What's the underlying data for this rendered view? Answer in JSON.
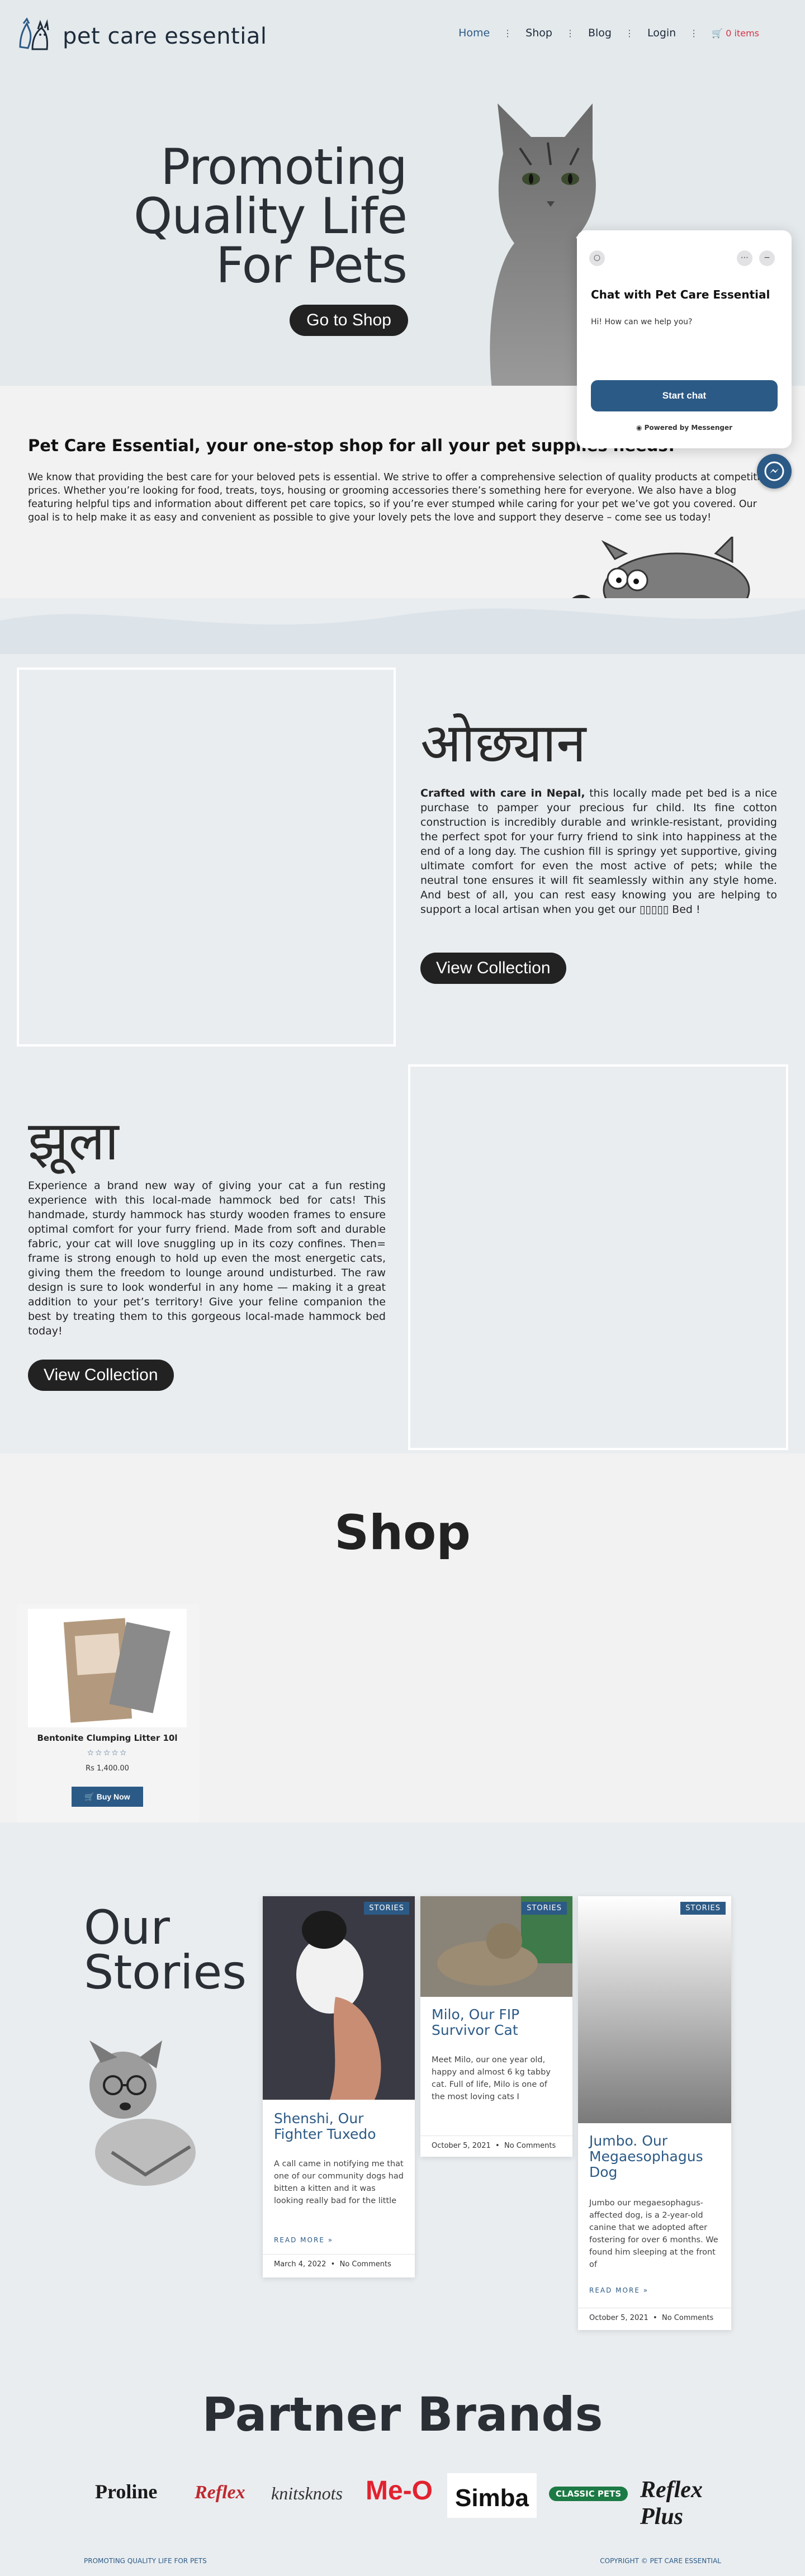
{
  "header": {
    "brand": "pet care essential",
    "nav": [
      {
        "label": "Home"
      },
      {
        "label": "Shop"
      },
      {
        "label": "Blog"
      },
      {
        "label": "Login"
      }
    ],
    "cart_label": "0 items"
  },
  "hero": {
    "title_line1": "Promoting",
    "title_line2": "Quality Life",
    "title_line3": "For Pets",
    "cta": "Go to Shop"
  },
  "chat": {
    "title": "Chat with Pet Care Essential",
    "subtitle": "Hi! How can we help you?",
    "button": "Start chat",
    "powered_by": "Powered by Messenger"
  },
  "intro": {
    "title": "Pet Care Essential, your one-stop shop for all your pet supplies needs!",
    "body": "We know that providing the best care for your beloved pets is essential. We strive to offer a comprehensive selection of quality products at competitive prices. Whether you’re looking for food, treats, toys, housing or grooming accessories there’s something here for everyone. We also have a blog featuring helpful tips and information about different pet care topics, so if you’re ever stumped while caring for your pet we’ve got you covered. Our goal is to help make it as easy and convenient as possible to give your lovely pets the love and support they deserve – come see us today!"
  },
  "bed": {
    "title": "ओछ्यान",
    "lead": "Crafted with care in Nepal,",
    "body": "this locally made pet bed is a nice purchase to pamper your precious fur child. Its fine cotton construction is incredibly durable and wrinkle-resistant, providing the perfect spot for your furry friend to sink into happiness at the end of a long day. The cushion fill is springy yet supportive, giving ultimate comfort for even the most active of pets; while the neutral tone ensures it will fit seamlessly within any style home. And best of all, you can rest easy knowing you are helping to support a local artisan when you get our ▯▯▯▯▯ Bed !",
    "cta": "View Collection"
  },
  "hammock": {
    "title": "झूला",
    "body": "Experience a brand new way of giving your cat a fun resting experience with this local-made hammock bed for cats! This handmade, sturdy hammock has sturdy wooden frames to ensure optimal comfort for your furry friend. Made from soft and durable fabric, your cat will love snuggling up in its cozy confines. Then= frame is strong enough to hold up even the most energetic cats, giving them the freedom to lounge around undisturbed. The raw design is sure to look wonderful in any home — making it a great addition to your pet’s territory! Give your feline companion the best by treating them to this gorgeous local-made hammock bed today!",
    "cta": "View Collection"
  },
  "shop": {
    "title": "Shop",
    "product": {
      "name": "Bentonite Clumping Litter 10l",
      "rating": 0,
      "stars": "☆☆☆☆☆",
      "price": "Rs 1,400.00",
      "button": "Buy Now"
    }
  },
  "stories": {
    "title_line1": "Our",
    "title_line2": "Stories",
    "posts": [
      {
        "badge": "STORIES",
        "title": "Shenshi, Our Fighter Tuxedo",
        "excerpt": "A call came in notifying me that one of our community dogs had bitten a kitten and it was looking really bad for the little",
        "more": "READ MORE »",
        "date": "March 4, 2022",
        "comments": "No Comments"
      },
      {
        "badge": "STORIES",
        "title": "Milo, Our FIP Survivor Cat",
        "excerpt": "Meet Milo, our one year old, happy and almost 6 kg tabby cat. Full of life, Milo is one of the most loving cats I",
        "date": "October 5, 2021",
        "comments": "No Comments"
      },
      {
        "badge": "STORIES",
        "title": "Jumbo. Our Megaesophagus Dog",
        "excerpt": "Jumbo our megaesophagus-affected dog, is a 2-year-old canine that we adopted after fostering for over 6 months. We found him sleeping at the front of",
        "more": "READ MORE »",
        "date": "October 5, 2021",
        "comments": "No Comments"
      }
    ]
  },
  "partners": {
    "title": "Partner Brands",
    "brands": [
      "Proline",
      "Reflex",
      "knitsknots",
      "Me-O",
      "Simba",
      "CLASSIC PETS",
      "Reflex Plus"
    ]
  },
  "footer": {
    "left": "PROMOTING QUALITY LIFE FOR PETS",
    "right": "COPYRIGHT © PET CARE ESSENTIAL"
  },
  "colors": {
    "accent": "#2c5a86",
    "cart": "#d63447",
    "dark_button": "#222222",
    "hero_bg": "#e4e9ec"
  }
}
